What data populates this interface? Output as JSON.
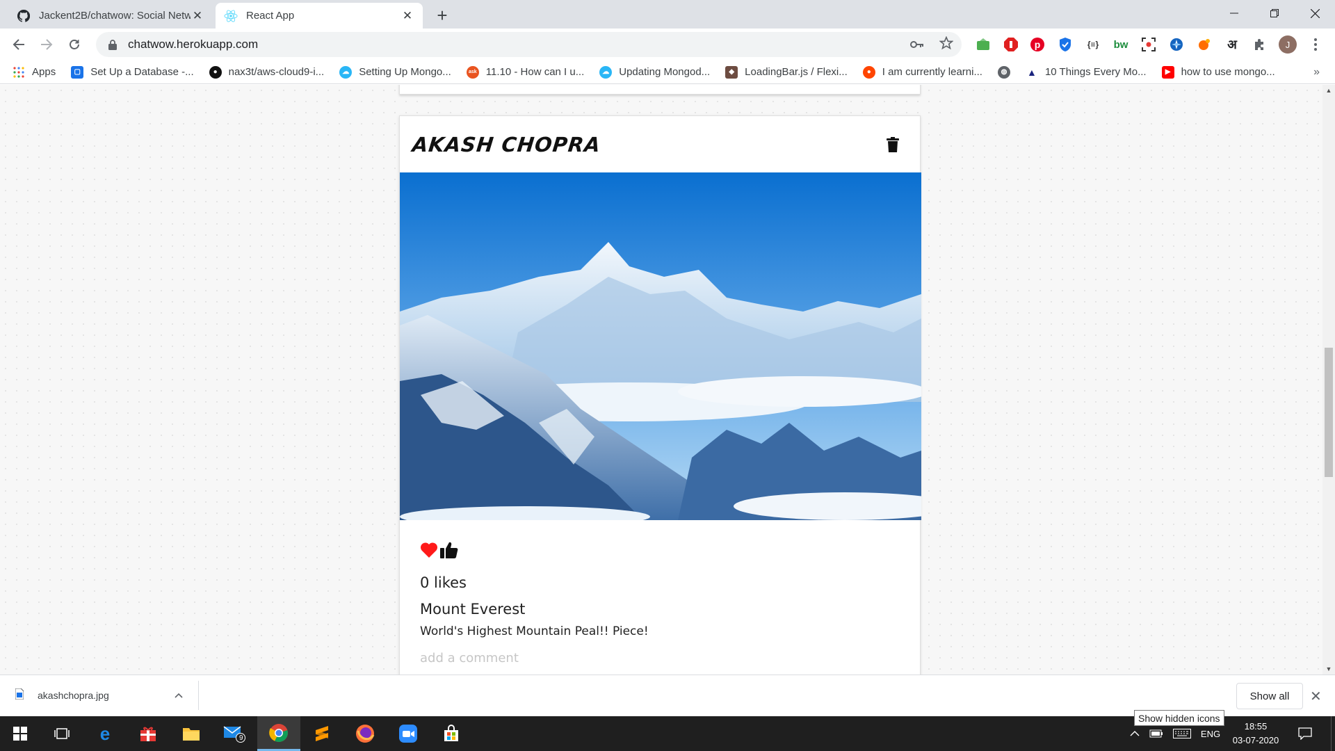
{
  "browser": {
    "tabs": [
      {
        "title": "Jackent2B/chatwow: Social Netw",
        "icon": "github-icon",
        "active": false
      },
      {
        "title": "React App",
        "icon": "react-icon",
        "active": true
      }
    ],
    "url": "chatwow.herokuapp.com",
    "avatar_initial": "J",
    "bookmarks": [
      {
        "label": "Apps",
        "icon": "apps-grid-icon"
      },
      {
        "label": "Set Up a Database -...",
        "icon": "database-icon"
      },
      {
        "label": "nax3t/aws-cloud9-i...",
        "icon": "github-icon"
      },
      {
        "label": "Setting Up Mongo...",
        "icon": "cloud-icon"
      },
      {
        "label": "11.10 - How can I u...",
        "icon": "ask-icon"
      },
      {
        "label": "Updating Mongod...",
        "icon": "cloud-icon"
      },
      {
        "label": "LoadingBar.js / Flexi...",
        "icon": "codepen-icon"
      },
      {
        "label": "I am currently learni...",
        "icon": "reddit-icon"
      },
      {
        "label": "",
        "icon": "globe-icon"
      },
      {
        "label": "10 Things Every Mo...",
        "icon": "arch-icon"
      },
      {
        "label": "how to use mongo...",
        "icon": "youtube-icon"
      }
    ],
    "extension_labels": {
      "json": "{≡}",
      "bw": "bw",
      "hindi": "अ"
    }
  },
  "post": {
    "author": "Akash Chopra",
    "likes": "0 likes",
    "title": "Mount Everest",
    "caption": "World's Highest Mountain Peal!! Piece!",
    "comment_placeholder": "add a comment"
  },
  "download": {
    "filename": "akashchopra.jpg",
    "show_all": "Show all"
  },
  "taskbar": {
    "mail_badge": "9",
    "language": "ENG",
    "time": "18:55",
    "date": "03-07-2020",
    "tooltip": "Show hidden icons"
  },
  "colors": {
    "heart": "#ff1a1a",
    "tab_strip": "#dee1e6",
    "taskbar": "#1f1f1f"
  }
}
